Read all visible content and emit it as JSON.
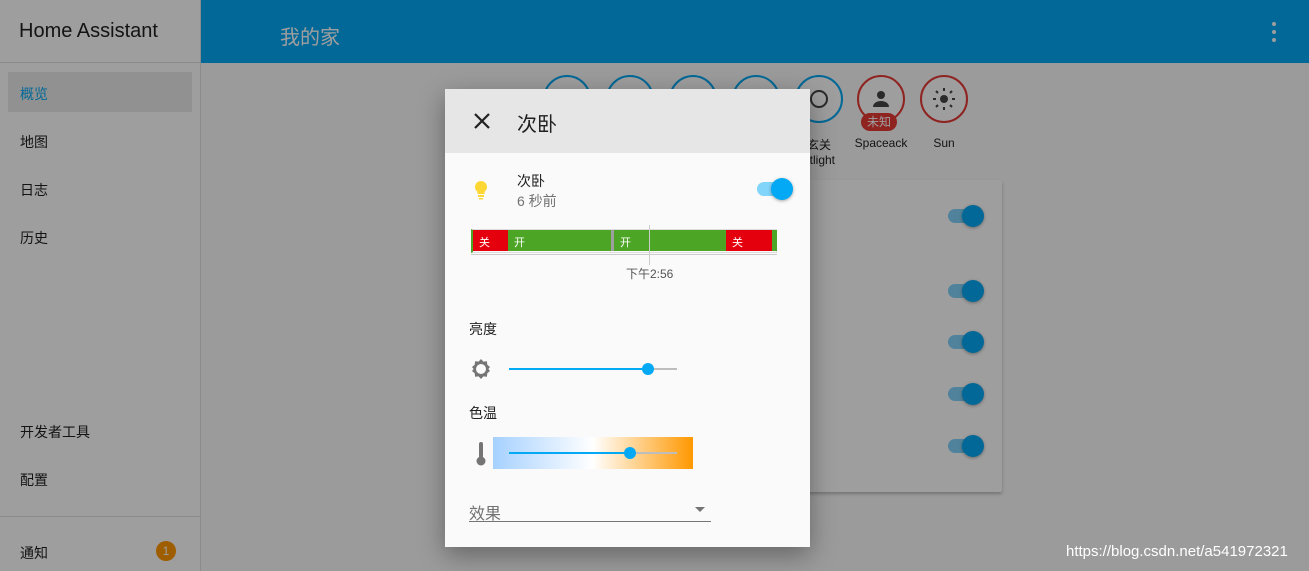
{
  "app": {
    "title": "Home Assistant"
  },
  "sidebar": {
    "items": [
      {
        "label": "概览"
      },
      {
        "label": "地图"
      },
      {
        "label": "日志"
      },
      {
        "label": "历史"
      },
      {
        "label": "开发者工具"
      },
      {
        "label": "配置"
      },
      {
        "label": "通知"
      }
    ],
    "notification_count": "1"
  },
  "header": {
    "title": "我的家",
    "menu_icon": "more-vert-icon"
  },
  "badges": [
    {
      "label": "",
      "icon": "badge-icon"
    },
    {
      "label": "",
      "icon": "badge-icon"
    },
    {
      "label": "",
      "icon": "badge-icon"
    },
    {
      "label": "",
      "icon": "badge-icon"
    },
    {
      "label": "玄关",
      "label2": "htlight",
      "icon": "circle-outline-icon"
    },
    {
      "label": "Spaceack",
      "tag": "未知",
      "icon": "person-icon"
    },
    {
      "label": "Sun",
      "icon": "sun-icon"
    }
  ],
  "dialog": {
    "title": "次卧",
    "close_icon": "close-icon",
    "entity": {
      "name": "次卧",
      "last_changed": "6 秒前",
      "icon": "lightbulb-icon",
      "state_on": true
    },
    "history": {
      "segments": [
        {
          "label": "关",
          "state": "off"
        },
        {
          "label": "开",
          "state": "on"
        },
        {
          "label": "开",
          "state": "on"
        },
        {
          "label": "关",
          "state": "off"
        }
      ],
      "time_label": "下午2:56"
    },
    "brightness": {
      "label": "亮度",
      "value": 0.83,
      "icon": "brightness-icon"
    },
    "color_temp": {
      "label": "色温",
      "value": 0.72,
      "icon": "thermometer-icon"
    },
    "effect": {
      "label": "效果"
    }
  },
  "watermark": "https://blog.csdn.net/a541972321",
  "colors": {
    "accent": "#03a9f4",
    "on": "#4ca524",
    "off": "#e5000d",
    "badge_red": "#e53935",
    "notify": "#ff9800"
  }
}
